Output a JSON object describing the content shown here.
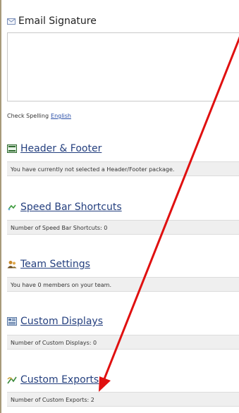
{
  "signature": {
    "title": "Email Signature",
    "spell_label": "Check Spelling",
    "spell_language": "English"
  },
  "sections": {
    "header_footer": {
      "title": "Header & Footer",
      "info": "You have currently not selected a Header/Footer package."
    },
    "speed_bar": {
      "title": "Speed Bar Shortcuts",
      "info": "Number of Speed Bar Shortcuts: 0"
    },
    "team_settings": {
      "title": "Team Settings",
      "info": "You have 0 members on your team."
    },
    "custom_displays": {
      "title": "Custom Displays",
      "info": "Number of Custom Displays: 0"
    },
    "custom_exports": {
      "title": "Custom Exports",
      "info": "Number of Custom Exports: 2"
    }
  },
  "colors": {
    "link": "#25407f",
    "arrow": "#e01010",
    "info_bar": "#efefef"
  }
}
